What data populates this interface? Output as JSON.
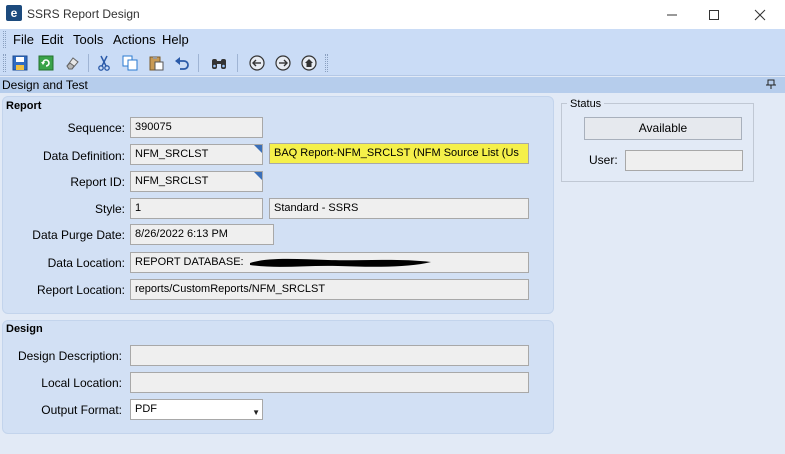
{
  "window": {
    "title": "SSRS Report Design",
    "icon_letter": "e"
  },
  "window_controls": [
    "minimize-icon",
    "maximize-icon",
    "close-icon"
  ],
  "menu": [
    "File",
    "Edit",
    "Tools",
    "Actions",
    "Help"
  ],
  "toolbar": [
    "save-icon",
    "refresh-icon",
    "clear-icon",
    "cut-icon",
    "copy-icon",
    "paste-icon",
    "undo-icon",
    "search-icon",
    "back-icon",
    "forward-icon",
    "home-icon"
  ],
  "panel": {
    "title": "Design and Test"
  },
  "report": {
    "title": "Report",
    "sequence": {
      "label": "Sequence:",
      "value": "390075"
    },
    "data_definition": {
      "label": "Data Definition:",
      "value": "NFM_SRCLST",
      "description": "BAQ Report-NFM_SRCLST (NFM Source List (Us"
    },
    "report_id": {
      "label": "Report ID:",
      "value": "NFM_SRCLST"
    },
    "style": {
      "label": "Style:",
      "value": "1",
      "description": "Standard - SSRS"
    },
    "data_purge_date": {
      "label": "Data Purge Date:",
      "value": "8/26/2022 6:13 PM"
    },
    "data_location": {
      "label": "Data Location:",
      "value": "REPORT DATABASE:"
    },
    "report_location": {
      "label": "Report Location:",
      "value": "reports/CustomReports/NFM_SRCLST"
    }
  },
  "design": {
    "title": "Design",
    "design_description": {
      "label": "Design Description:",
      "value": ""
    },
    "local_location": {
      "label": "Local Location:",
      "value": ""
    },
    "output_format": {
      "label": "Output Format:",
      "value": "PDF"
    }
  },
  "status": {
    "title": "Status",
    "button_label": "Available",
    "user_label": "User:",
    "user_value": ""
  }
}
